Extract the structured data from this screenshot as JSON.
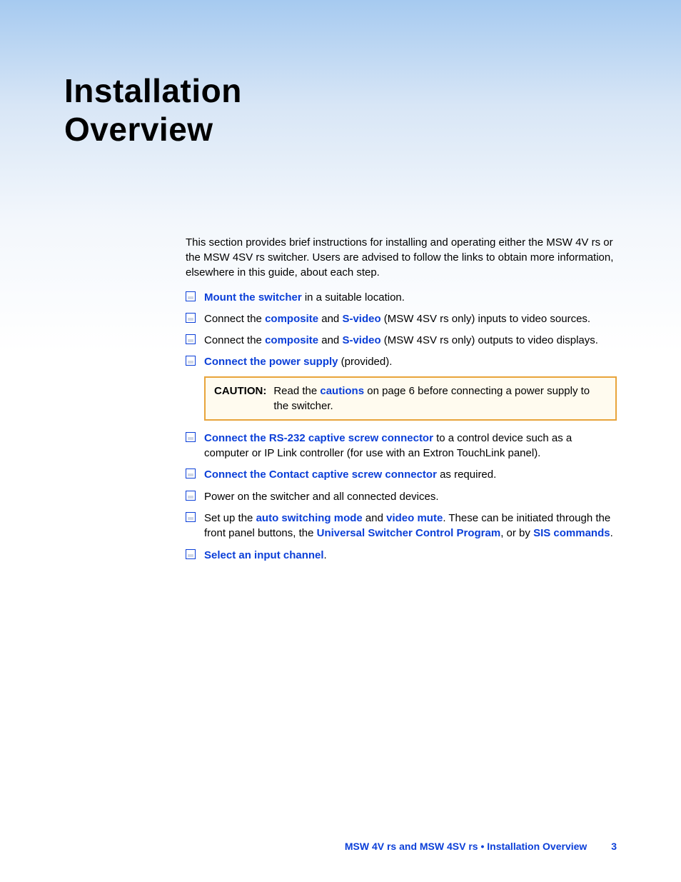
{
  "title_line1": "Installation",
  "title_line2": "Overview",
  "intro": "This section provides brief instructions for installing and operating either the MSW 4V rs or the MSW 4SV rs switcher. Users are advised to follow the links to obtain more information, elsewhere in this guide, about each step.",
  "items": {
    "i1_link": "Mount the switcher",
    "i1_rest": " in a suitable location.",
    "i2_pre": "Connect the ",
    "i2_link1": "composite",
    "i2_mid": " and ",
    "i2_link2": "S-video",
    "i2_rest": " (MSW 4SV rs only) inputs to video sources.",
    "i3_pre": "Connect the ",
    "i3_link1": "composite",
    "i3_mid": " and ",
    "i3_link2": "S-video",
    "i3_rest": " (MSW 4SV rs only) outputs to video displays.",
    "i4_link": "Connect the power supply",
    "i4_rest": " (provided).",
    "i5_link": "Connect the RS-232 captive screw connector",
    "i5_rest": " to a control device such as a computer or IP Link controller (for use with an Extron TouchLink panel).",
    "i6_link": "Connect the Contact captive screw connector",
    "i6_rest": " as required.",
    "i7_text": "Power on the switcher and all connected devices.",
    "i8_pre": "Set up the ",
    "i8_link1": "auto switching mode",
    "i8_mid1": " and ",
    "i8_link2": "video mute",
    "i8_mid2": ". These can be initiated through the front panel buttons, the ",
    "i8_link3": "Universal Switcher Control Program",
    "i8_mid3": ", or by ",
    "i8_link4": "SIS commands",
    "i8_end": ".",
    "i9_link": "Select an input channel",
    "i9_end": "."
  },
  "caution": {
    "label": "CAUTION:",
    "pre": "Read the ",
    "link": "cautions",
    "rest": " on page 6 before connecting a power supply to the switcher."
  },
  "footer": {
    "text": "MSW 4V rs and MSW 4SV rs • Installation Overview",
    "page": "3"
  }
}
